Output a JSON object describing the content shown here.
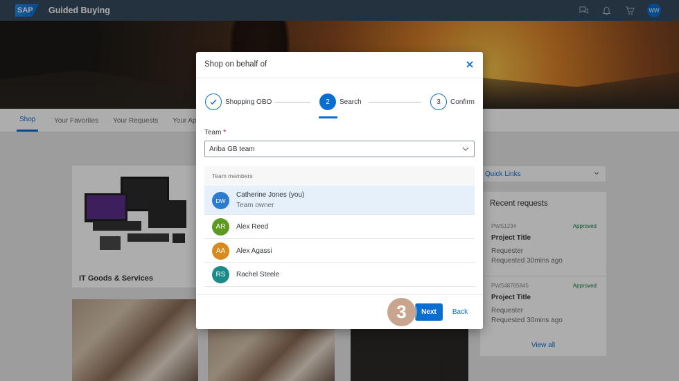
{
  "shell": {
    "logo": "SAP",
    "title": "Guided Buying",
    "avatar": "WW"
  },
  "tabs": [
    "Shop",
    "Your Favorites",
    "Your Requests",
    "Your Ap"
  ],
  "background": {
    "card1_label": "IT Goods & Services",
    "quick_links": "Quick Links",
    "recent_title": "Recent requests",
    "requests": [
      {
        "id": "PWS1234",
        "status": "Approved",
        "title": "Project Title",
        "line1": "Requester",
        "line2": "Requested 30mins ago"
      },
      {
        "id": "PWS48765845",
        "status": "Approved",
        "title": "Project Title",
        "line1": "Requester",
        "line2": "Requested 30mins ago"
      }
    ],
    "view_all": "View all"
  },
  "dialog": {
    "title": "Shop on behalf of",
    "steps": [
      {
        "label": "Shopping OBO",
        "state": "done"
      },
      {
        "number": "2",
        "label": "Search",
        "state": "current"
      },
      {
        "number": "3",
        "label": "Confirm",
        "state": "future"
      }
    ],
    "team_label": "Team",
    "required_marker": "*",
    "team_value": "Ariba GB team",
    "members_header": "Team members",
    "members": [
      {
        "initials": "DW",
        "name": "Catherine Jones (you)",
        "role": "Team owner",
        "color": "#2b7bd1",
        "selected": true
      },
      {
        "initials": "AR",
        "name": "Alex Reed",
        "role": "",
        "color": "#5b9a1e",
        "selected": false
      },
      {
        "initials": "AA",
        "name": "Alex Agassi",
        "role": "",
        "color": "#d98a1c",
        "selected": false
      },
      {
        "initials": "RS",
        "name": "Rachel Steele",
        "role": "",
        "color": "#1a8a8a",
        "selected": false
      }
    ],
    "next_label": "Next",
    "back_label": "Back"
  },
  "annotation": {
    "step_marker": "3"
  },
  "colors": {
    "shell": "#354a5f",
    "accent": "#0a6ed1",
    "approved": "#107e3e"
  }
}
